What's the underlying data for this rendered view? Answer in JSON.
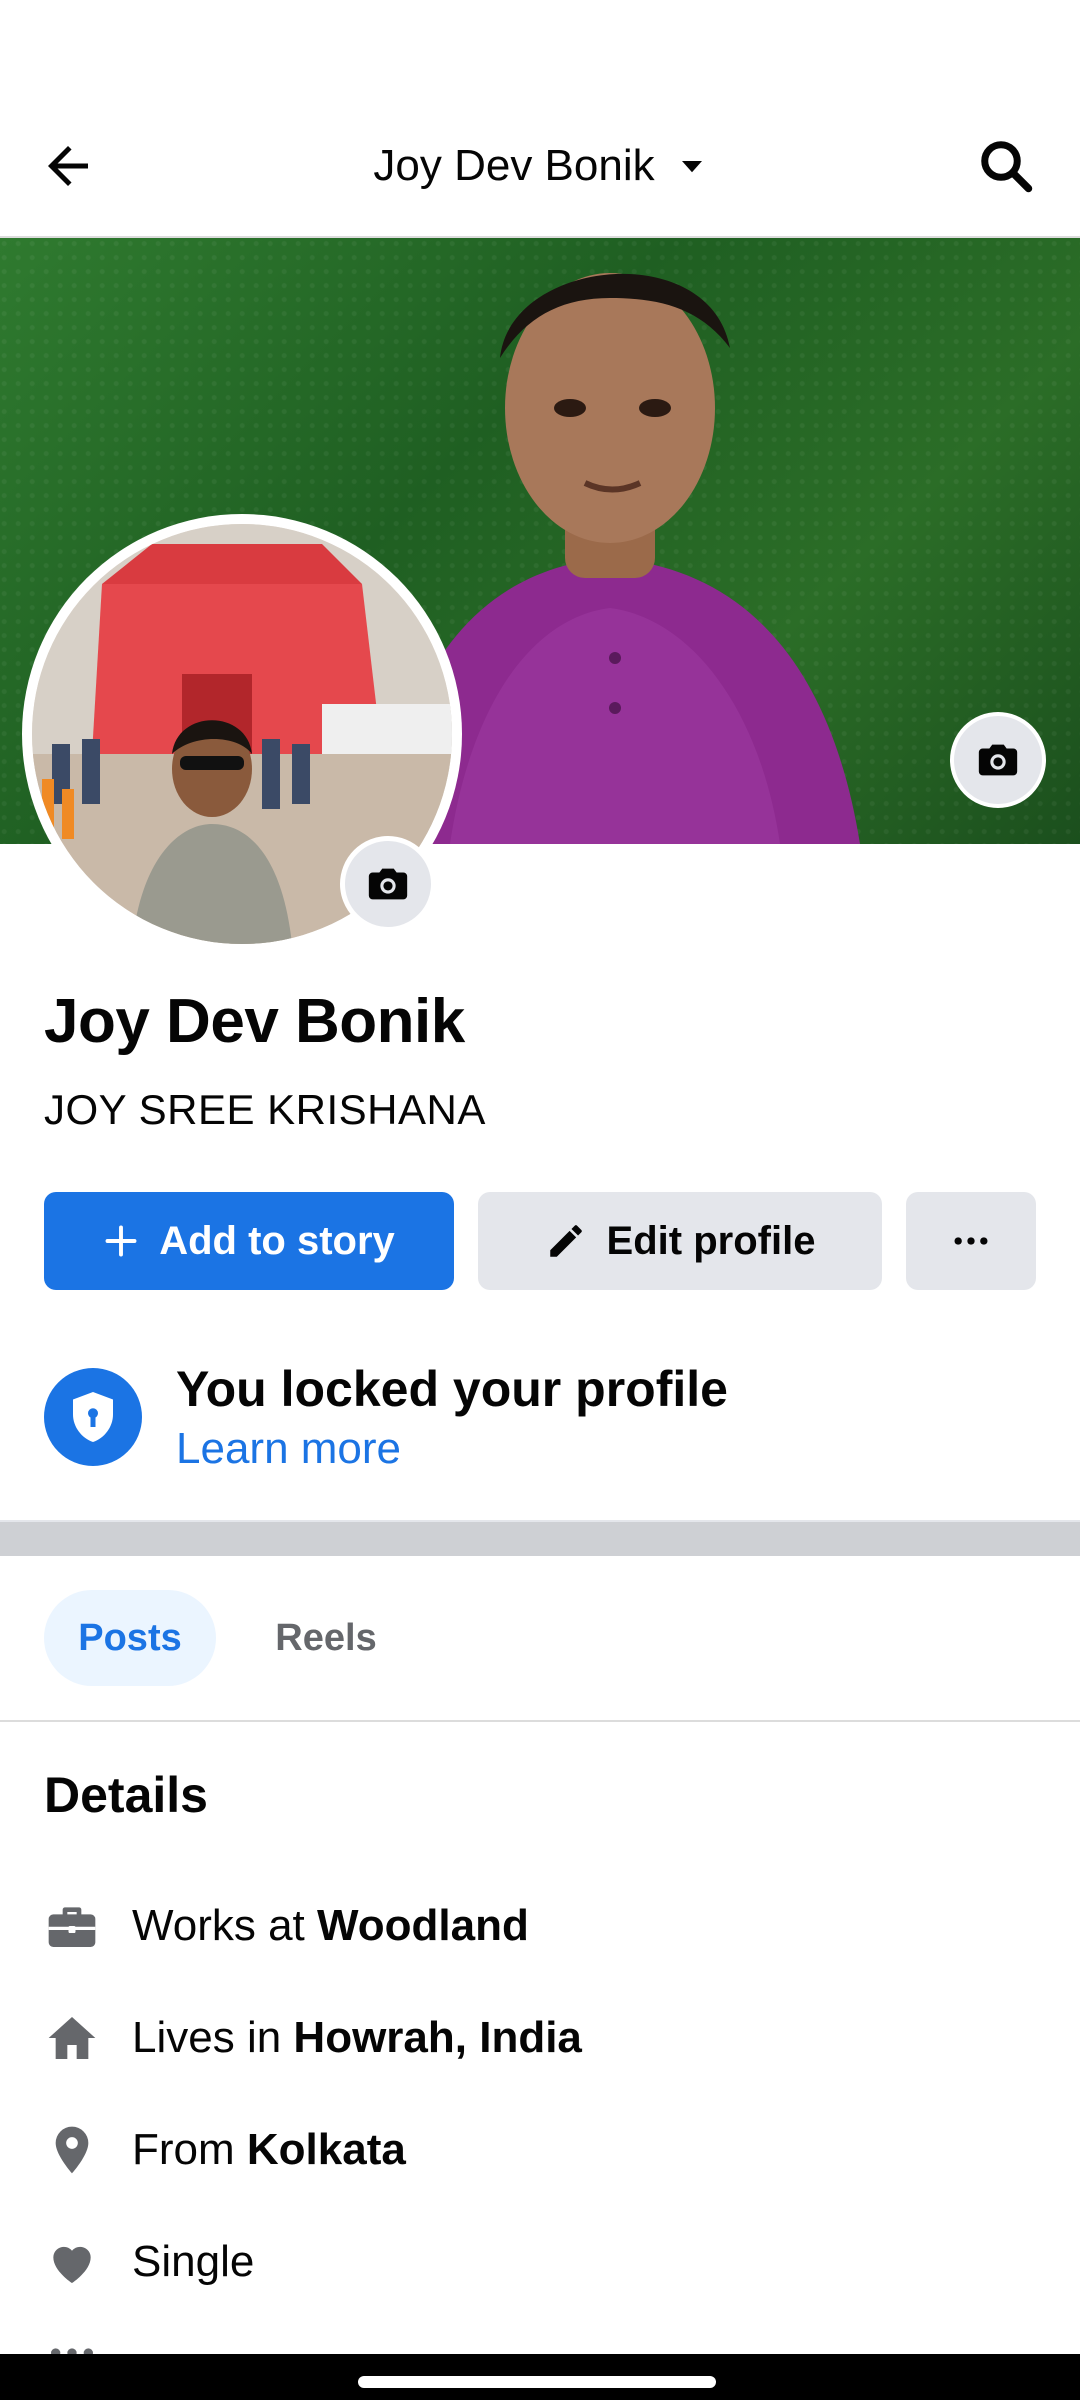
{
  "header": {
    "title": "Joy Dev Bonik",
    "icons": {
      "back": "arrow-left-icon",
      "title_dropdown": "caret-down-icon",
      "search": "search-icon"
    }
  },
  "profile": {
    "name": "Joy Dev Bonik",
    "bio": "JOY SREE KRISHANA"
  },
  "actions": {
    "add_story_label": "Add to story",
    "edit_profile_label": "Edit profile",
    "more_icon": "more-horizontal-icon"
  },
  "locked": {
    "title": "You locked your profile",
    "link": "Learn more"
  },
  "tabs": [
    {
      "label": "Posts",
      "active": true
    },
    {
      "label": "Reels",
      "active": false
    }
  ],
  "details": {
    "title": "Details",
    "items": [
      {
        "icon": "briefcase-icon",
        "prefix": "Works at ",
        "value": "Woodland"
      },
      {
        "icon": "home-icon",
        "prefix": "Lives in ",
        "value": "Howrah, India"
      },
      {
        "icon": "location-pin-icon",
        "prefix": "From ",
        "value": "Kolkata"
      },
      {
        "icon": "heart-icon",
        "prefix": "Single",
        "value": ""
      }
    ]
  },
  "colors": {
    "accent": "#1b74e4",
    "button_gray": "#e4e6eb",
    "tab_active_bg": "#ebf5ff",
    "icon_gray": "#65676b"
  }
}
